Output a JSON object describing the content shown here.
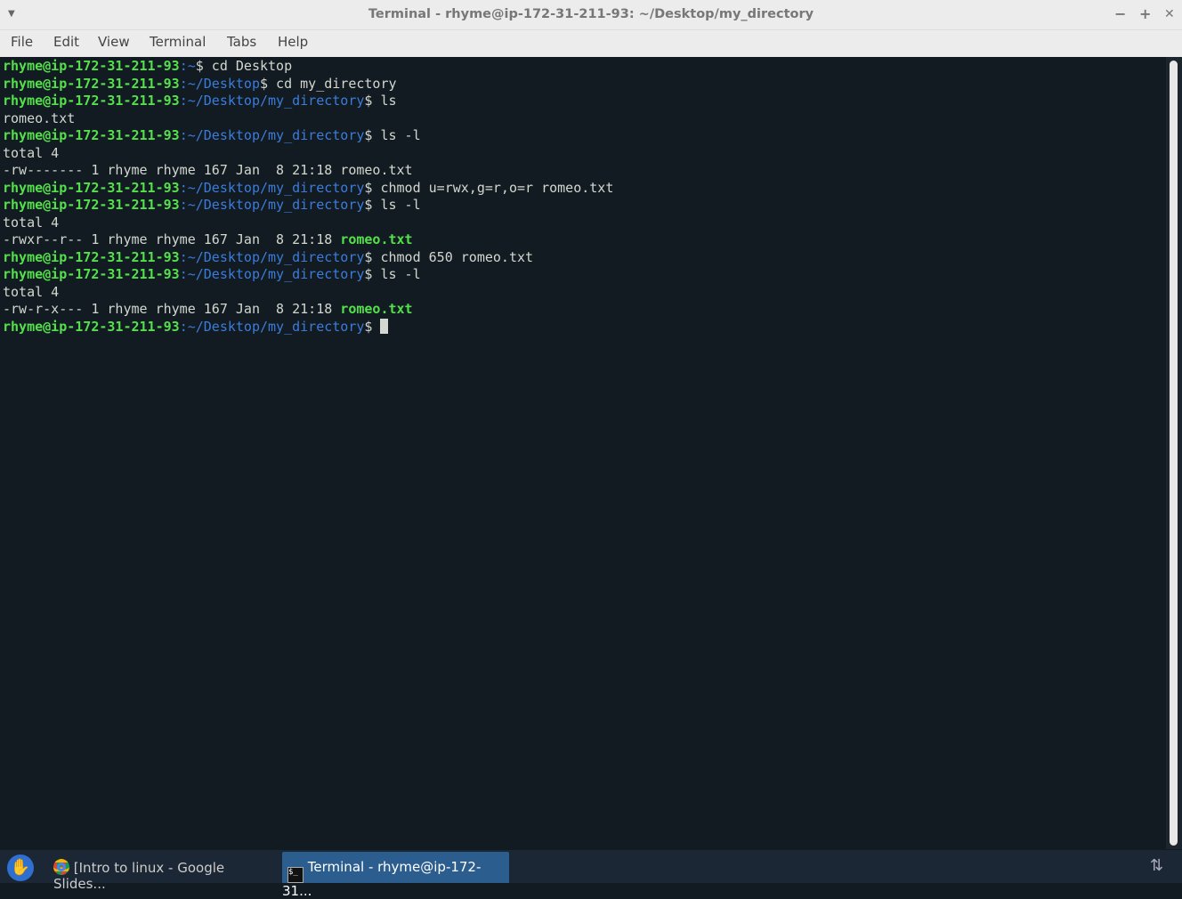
{
  "window": {
    "title": "Terminal - rhyme@ip-172-31-211-93: ~/Desktop/my_directory",
    "minimize": "−",
    "maximize": "+",
    "close": "✕"
  },
  "menu": [
    "File",
    "Edit",
    "View",
    "Terminal",
    "Tabs",
    "Help"
  ],
  "terminal": {
    "lines": [
      [
        [
          "g",
          "rhyme@ip-172-31-211-93"
        ],
        [
          "b",
          ":~"
        ],
        [
          "",
          "$ cd Desktop"
        ]
      ],
      [
        [
          "g",
          "rhyme@ip-172-31-211-93"
        ],
        [
          "b",
          ":~/Desktop"
        ],
        [
          "",
          "$ cd my_directory"
        ]
      ],
      [
        [
          "g",
          "rhyme@ip-172-31-211-93"
        ],
        [
          "b",
          ":~/Desktop/my_directory"
        ],
        [
          "",
          "$ ls"
        ]
      ],
      [
        [
          "",
          "romeo.txt"
        ]
      ],
      [
        [
          "g",
          "rhyme@ip-172-31-211-93"
        ],
        [
          "b",
          ":~/Desktop/my_directory"
        ],
        [
          "",
          "$ ls -l"
        ]
      ],
      [
        [
          "",
          "total 4"
        ]
      ],
      [
        [
          "",
          "-rw------- 1 rhyme rhyme 167 Jan  8 21:18 romeo.txt"
        ]
      ],
      [
        [
          "g",
          "rhyme@ip-172-31-211-93"
        ],
        [
          "b",
          ":~/Desktop/my_directory"
        ],
        [
          "",
          "$ chmod u=rwx,g=r,o=r romeo.txt"
        ]
      ],
      [
        [
          "g",
          "rhyme@ip-172-31-211-93"
        ],
        [
          "b",
          ":~/Desktop/my_directory"
        ],
        [
          "",
          "$ ls -l"
        ]
      ],
      [
        [
          "",
          "total 4"
        ]
      ],
      [
        [
          "",
          "-rwxr--r-- 1 rhyme rhyme 167 Jan  8 21:18 "
        ],
        [
          "g",
          "romeo.txt"
        ]
      ],
      [
        [
          "g",
          "rhyme@ip-172-31-211-93"
        ],
        [
          "b",
          ":~/Desktop/my_directory"
        ],
        [
          "",
          "$ chmod 650 romeo.txt"
        ]
      ],
      [
        [
          "g",
          "rhyme@ip-172-31-211-93"
        ],
        [
          "b",
          ":~/Desktop/my_directory"
        ],
        [
          "",
          "$ ls -l"
        ]
      ],
      [
        [
          "",
          "total 4"
        ]
      ],
      [
        [
          "",
          "-rw-r-x--- 1 rhyme rhyme 167 Jan  8 21:18 "
        ],
        [
          "g",
          "romeo.txt"
        ]
      ],
      [
        [
          "g",
          "rhyme@ip-172-31-211-93"
        ],
        [
          "b",
          ":~/Desktop/my_directory"
        ],
        [
          "",
          "$ "
        ]
      ]
    ]
  },
  "taskbar": {
    "chrome_task": "[Intro to linux - Google Slides...",
    "terminal_task": "Terminal - rhyme@ip-172-31..."
  }
}
